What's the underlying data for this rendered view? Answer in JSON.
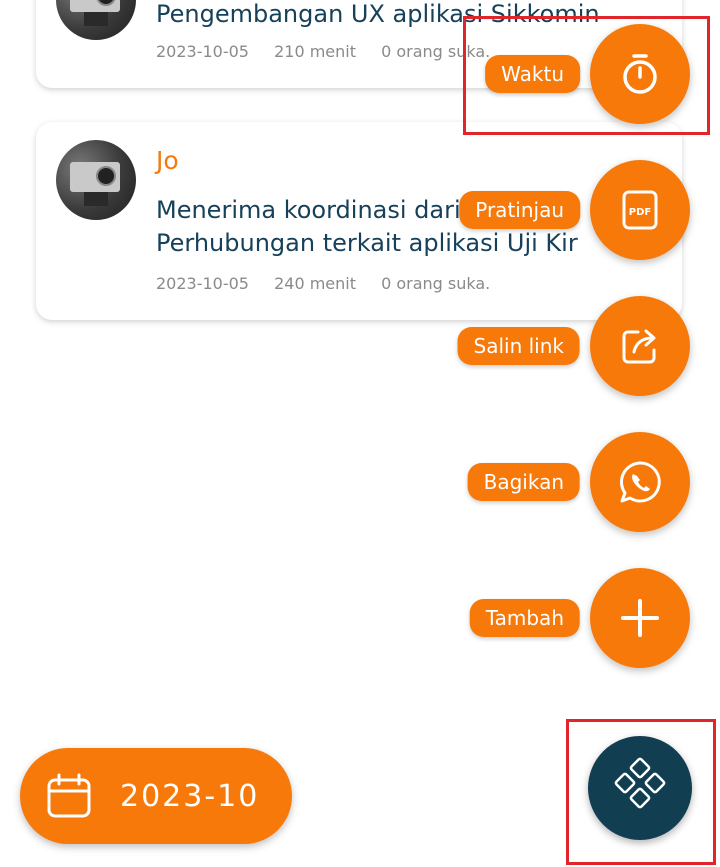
{
  "cards": [
    {
      "author": "",
      "task_lines": [
        "Pengembangan UX aplikasi Sikkomin"
      ],
      "date": "2023-10-05",
      "duration": "210 menit",
      "likes": "0 orang suka."
    },
    {
      "author": "Jo",
      "task_lines": [
        "Menerima koordinasi dari Dinas",
        "Perhubungan terkait aplikasi Uji Kir"
      ],
      "date": "2023-10-05",
      "duration": "240 menit",
      "likes": "0 orang suka."
    }
  ],
  "speed_dial": [
    {
      "label": "Waktu",
      "icon": "stopwatch-icon"
    },
    {
      "label": "Pratinjau",
      "icon": "pdf-icon",
      "icon_text": "PDF"
    },
    {
      "label": "Salin link",
      "icon": "share-icon"
    },
    {
      "label": "Bagikan",
      "icon": "whatsapp-icon"
    },
    {
      "label": "Tambah",
      "icon": "plus-icon"
    }
  ],
  "main_fab": {
    "icon": "diamond-grid-icon"
  },
  "month_selector": {
    "value": "2023-10",
    "icon": "calendar-icon"
  },
  "colors": {
    "accent": "#f7790a",
    "primary_dark": "#123e52",
    "task_text": "#17415a",
    "highlight": "#e0262b"
  }
}
